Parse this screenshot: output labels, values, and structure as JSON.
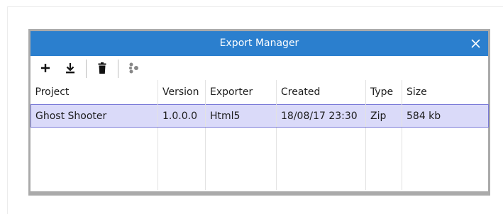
{
  "window": {
    "title": "Export Manager",
    "accent": "#2b7fce"
  },
  "toolbar": {
    "buttons": [
      {
        "name": "add",
        "icon": "plus-icon"
      },
      {
        "name": "download",
        "icon": "download-icon"
      },
      {
        "name": "delete",
        "icon": "trash-icon"
      },
      {
        "name": "settings",
        "icon": "dots-cluster-icon"
      }
    ]
  },
  "table": {
    "columns": [
      "Project",
      "Version",
      "Exporter",
      "Created",
      "Type",
      "Size"
    ],
    "rows": [
      {
        "selected": true,
        "cells": [
          "Ghost Shooter",
          "1.0.0.0",
          "Html5",
          "18/08/17 23:30",
          "Zip",
          "584 kb"
        ]
      }
    ]
  }
}
